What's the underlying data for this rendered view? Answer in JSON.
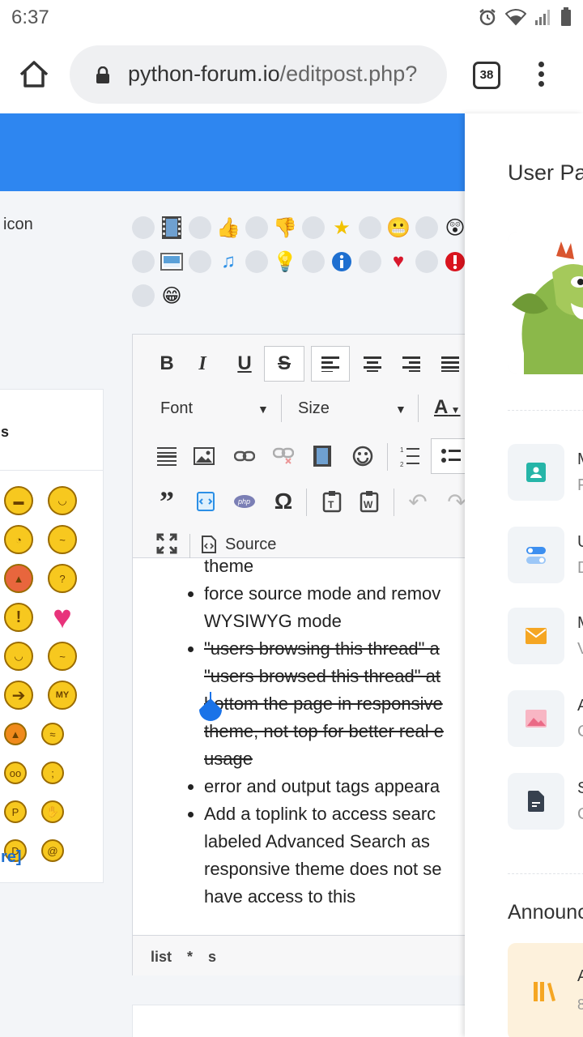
{
  "status_bar": {
    "time": "6:37"
  },
  "browser": {
    "url_host": "python-forum.io",
    "url_path": "/editpost.php?",
    "tab_count": "38"
  },
  "left_form": {
    "post_icon_label": "icon",
    "post_icons_row1": [
      "film",
      "thumbs-up",
      "thumbs-down",
      "star",
      "smile",
      "shocked"
    ],
    "post_icons_row2": [
      "image",
      "music",
      "lightbulb",
      "info",
      "heart",
      "exclamation"
    ],
    "post_icons_row3": [
      "grin"
    ]
  },
  "smilies": {
    "header": "s",
    "more_link": "re]",
    "rows": [
      [
        "cool",
        "grin"
      ],
      [
        "rolleyes",
        "confused"
      ],
      [
        "angry",
        "huh"
      ],
      [
        "exclamation",
        "heart"
      ],
      [
        "sleepy",
        "dodgy"
      ],
      [
        "arrow",
        "MY"
      ],
      [
        "devil",
        "sick"
      ],
      [
        "shy",
        "cry"
      ],
      [
        "tongue",
        "hand"
      ],
      [
        "big-smile",
        "rolleyes2"
      ]
    ]
  },
  "editor": {
    "font_label": "Font",
    "size_label": "Size",
    "color_label": "A",
    "source_label": "Source",
    "content": [
      {
        "type": "continuation",
        "text": "theme"
      },
      {
        "type": "bullet",
        "lines": [
          "force source mode and remov",
          "WYSIWYG mode"
        ]
      },
      {
        "type": "bullet-strike",
        "lines": [
          "\"users browsing this thread\" a",
          "\"users browsed this thread\" at",
          "bottom the page in responsive",
          "theme, not top for better real e",
          "usage"
        ]
      },
      {
        "type": "bullet",
        "lines": [
          "error and output tags appeara"
        ]
      },
      {
        "type": "bullet",
        "lines": [
          "Add a toplink to access searc",
          "labeled Advanced Search as",
          "responsive theme does not se",
          "have access to this"
        ]
      }
    ],
    "path": "list * s"
  },
  "panel": {
    "title": "User Pa",
    "items": [
      {
        "letter": "M",
        "sub": "F",
        "color": "#26b5a8"
      },
      {
        "letter": "U",
        "sub": "D",
        "color": "#3d8ff0"
      },
      {
        "letter": "M",
        "sub": "V",
        "color": "#f5a623"
      },
      {
        "letter": "A",
        "sub": "C",
        "color": "#f08aa0"
      },
      {
        "letter": "S",
        "sub": "C",
        "color": "#37414f"
      }
    ],
    "announcements": "Announc",
    "announce_item": {
      "letter": "A",
      "sub": "8"
    }
  },
  "colors": {
    "blue_bar": "#2e86f0"
  }
}
